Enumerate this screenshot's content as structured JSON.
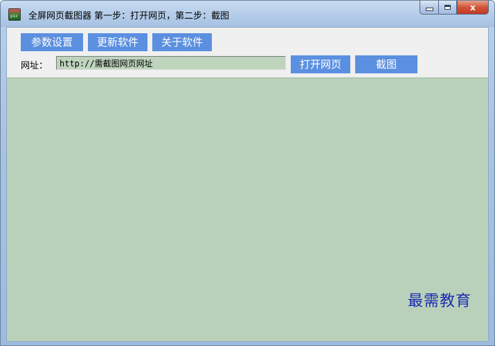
{
  "window": {
    "title": "全屏网页截图器  第一步：打开网页，第二步：截图",
    "icon_text": "pic",
    "minimize_symbol": "_",
    "maximize_symbol": "□",
    "close_symbol": "x"
  },
  "toolbar": {
    "params_label": "参数设置",
    "update_label": "更新软件",
    "about_label": "关于软件",
    "url_label": "网址：",
    "url_value": "http://需截图网页网址",
    "open_label": "打开网页",
    "screenshot_label": "截图"
  },
  "watermark": {
    "text": "最需教育"
  },
  "colors": {
    "button_bg": "#5b8fe0",
    "browser_bg": "#b9d1bb",
    "url_bg": "#bed4bd",
    "watermark": "#1a2bb0"
  }
}
